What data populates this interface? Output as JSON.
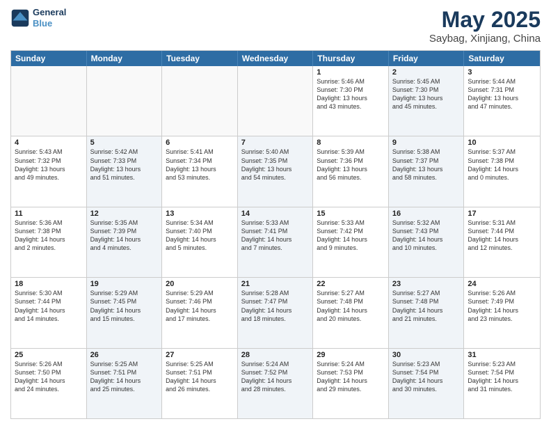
{
  "logo": {
    "line1": "General",
    "line2": "Blue"
  },
  "title": "May 2025",
  "subtitle": "Saybag, Xinjiang, China",
  "header_days": [
    "Sunday",
    "Monday",
    "Tuesday",
    "Wednesday",
    "Thursday",
    "Friday",
    "Saturday"
  ],
  "rows": [
    [
      {
        "day": "",
        "text": "",
        "shaded": false,
        "empty": true
      },
      {
        "day": "",
        "text": "",
        "shaded": false,
        "empty": true
      },
      {
        "day": "",
        "text": "",
        "shaded": false,
        "empty": true
      },
      {
        "day": "",
        "text": "",
        "shaded": false,
        "empty": true
      },
      {
        "day": "1",
        "text": "Sunrise: 5:46 AM\nSunset: 7:30 PM\nDaylight: 13 hours\nand 43 minutes.",
        "shaded": false,
        "empty": false
      },
      {
        "day": "2",
        "text": "Sunrise: 5:45 AM\nSunset: 7:30 PM\nDaylight: 13 hours\nand 45 minutes.",
        "shaded": true,
        "empty": false
      },
      {
        "day": "3",
        "text": "Sunrise: 5:44 AM\nSunset: 7:31 PM\nDaylight: 13 hours\nand 47 minutes.",
        "shaded": false,
        "empty": false
      }
    ],
    [
      {
        "day": "4",
        "text": "Sunrise: 5:43 AM\nSunset: 7:32 PM\nDaylight: 13 hours\nand 49 minutes.",
        "shaded": false,
        "empty": false
      },
      {
        "day": "5",
        "text": "Sunrise: 5:42 AM\nSunset: 7:33 PM\nDaylight: 13 hours\nand 51 minutes.",
        "shaded": true,
        "empty": false
      },
      {
        "day": "6",
        "text": "Sunrise: 5:41 AM\nSunset: 7:34 PM\nDaylight: 13 hours\nand 53 minutes.",
        "shaded": false,
        "empty": false
      },
      {
        "day": "7",
        "text": "Sunrise: 5:40 AM\nSunset: 7:35 PM\nDaylight: 13 hours\nand 54 minutes.",
        "shaded": true,
        "empty": false
      },
      {
        "day": "8",
        "text": "Sunrise: 5:39 AM\nSunset: 7:36 PM\nDaylight: 13 hours\nand 56 minutes.",
        "shaded": false,
        "empty": false
      },
      {
        "day": "9",
        "text": "Sunrise: 5:38 AM\nSunset: 7:37 PM\nDaylight: 13 hours\nand 58 minutes.",
        "shaded": true,
        "empty": false
      },
      {
        "day": "10",
        "text": "Sunrise: 5:37 AM\nSunset: 7:38 PM\nDaylight: 14 hours\nand 0 minutes.",
        "shaded": false,
        "empty": false
      }
    ],
    [
      {
        "day": "11",
        "text": "Sunrise: 5:36 AM\nSunset: 7:38 PM\nDaylight: 14 hours\nand 2 minutes.",
        "shaded": false,
        "empty": false
      },
      {
        "day": "12",
        "text": "Sunrise: 5:35 AM\nSunset: 7:39 PM\nDaylight: 14 hours\nand 4 minutes.",
        "shaded": true,
        "empty": false
      },
      {
        "day": "13",
        "text": "Sunrise: 5:34 AM\nSunset: 7:40 PM\nDaylight: 14 hours\nand 5 minutes.",
        "shaded": false,
        "empty": false
      },
      {
        "day": "14",
        "text": "Sunrise: 5:33 AM\nSunset: 7:41 PM\nDaylight: 14 hours\nand 7 minutes.",
        "shaded": true,
        "empty": false
      },
      {
        "day": "15",
        "text": "Sunrise: 5:33 AM\nSunset: 7:42 PM\nDaylight: 14 hours\nand 9 minutes.",
        "shaded": false,
        "empty": false
      },
      {
        "day": "16",
        "text": "Sunrise: 5:32 AM\nSunset: 7:43 PM\nDaylight: 14 hours\nand 10 minutes.",
        "shaded": true,
        "empty": false
      },
      {
        "day": "17",
        "text": "Sunrise: 5:31 AM\nSunset: 7:44 PM\nDaylight: 14 hours\nand 12 minutes.",
        "shaded": false,
        "empty": false
      }
    ],
    [
      {
        "day": "18",
        "text": "Sunrise: 5:30 AM\nSunset: 7:44 PM\nDaylight: 14 hours\nand 14 minutes.",
        "shaded": false,
        "empty": false
      },
      {
        "day": "19",
        "text": "Sunrise: 5:29 AM\nSunset: 7:45 PM\nDaylight: 14 hours\nand 15 minutes.",
        "shaded": true,
        "empty": false
      },
      {
        "day": "20",
        "text": "Sunrise: 5:29 AM\nSunset: 7:46 PM\nDaylight: 14 hours\nand 17 minutes.",
        "shaded": false,
        "empty": false
      },
      {
        "day": "21",
        "text": "Sunrise: 5:28 AM\nSunset: 7:47 PM\nDaylight: 14 hours\nand 18 minutes.",
        "shaded": true,
        "empty": false
      },
      {
        "day": "22",
        "text": "Sunrise: 5:27 AM\nSunset: 7:48 PM\nDaylight: 14 hours\nand 20 minutes.",
        "shaded": false,
        "empty": false
      },
      {
        "day": "23",
        "text": "Sunrise: 5:27 AM\nSunset: 7:48 PM\nDaylight: 14 hours\nand 21 minutes.",
        "shaded": true,
        "empty": false
      },
      {
        "day": "24",
        "text": "Sunrise: 5:26 AM\nSunset: 7:49 PM\nDaylight: 14 hours\nand 23 minutes.",
        "shaded": false,
        "empty": false
      }
    ],
    [
      {
        "day": "25",
        "text": "Sunrise: 5:26 AM\nSunset: 7:50 PM\nDaylight: 14 hours\nand 24 minutes.",
        "shaded": false,
        "empty": false
      },
      {
        "day": "26",
        "text": "Sunrise: 5:25 AM\nSunset: 7:51 PM\nDaylight: 14 hours\nand 25 minutes.",
        "shaded": true,
        "empty": false
      },
      {
        "day": "27",
        "text": "Sunrise: 5:25 AM\nSunset: 7:51 PM\nDaylight: 14 hours\nand 26 minutes.",
        "shaded": false,
        "empty": false
      },
      {
        "day": "28",
        "text": "Sunrise: 5:24 AM\nSunset: 7:52 PM\nDaylight: 14 hours\nand 28 minutes.",
        "shaded": true,
        "empty": false
      },
      {
        "day": "29",
        "text": "Sunrise: 5:24 AM\nSunset: 7:53 PM\nDaylight: 14 hours\nand 29 minutes.",
        "shaded": false,
        "empty": false
      },
      {
        "day": "30",
        "text": "Sunrise: 5:23 AM\nSunset: 7:54 PM\nDaylight: 14 hours\nand 30 minutes.",
        "shaded": true,
        "empty": false
      },
      {
        "day": "31",
        "text": "Sunrise: 5:23 AM\nSunset: 7:54 PM\nDaylight: 14 hours\nand 31 minutes.",
        "shaded": false,
        "empty": false
      }
    ]
  ]
}
